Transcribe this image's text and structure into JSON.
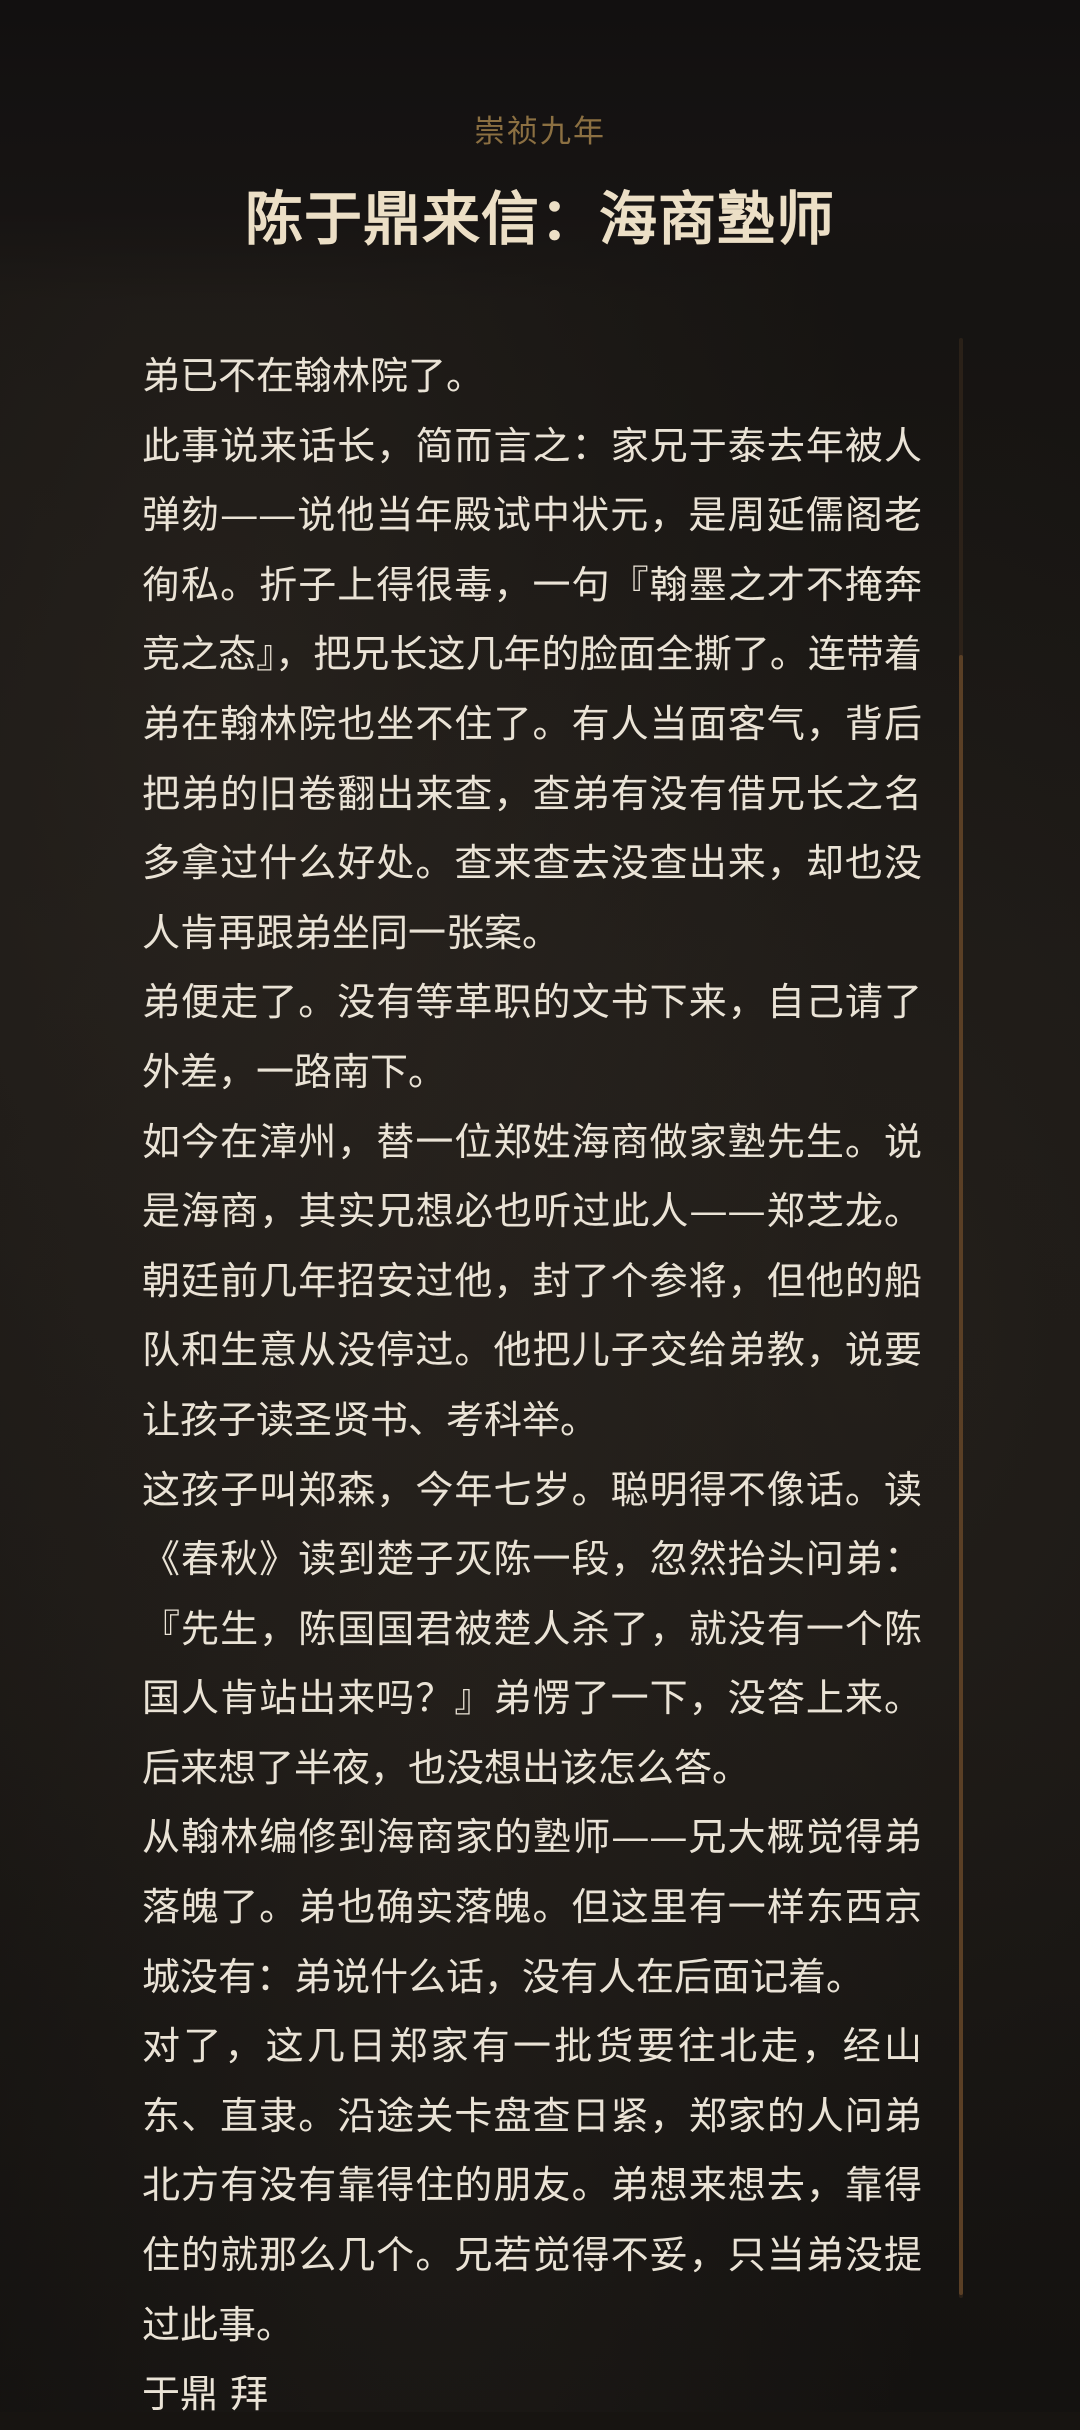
{
  "header": {
    "year": "崇祯九年",
    "title": "陈于鼎来信：海商塾师"
  },
  "letter": {
    "paragraphs": [
      "弟已不在翰林院了。",
      "此事说来话长，简而言之：家兄于泰去年被人弹劾——说他当年殿试中状元，是周延儒阁老徇私。折子上得很毒，一句『翰墨之才不掩奔竞之态』，把兄长这几年的脸面全撕了。连带着弟在翰林院也坐不住了。有人当面客气，背后把弟的旧卷翻出来查，查弟有没有借兄长之名多拿过什么好处。查来查去没查出来，却也没人肯再跟弟坐同一张案。",
      "弟便走了。没有等革职的文书下来，自己请了外差，一路南下。",
      "如今在漳州，替一位郑姓海商做家塾先生。说是海商，其实兄想必也听过此人——郑芝龙。朝廷前几年招安过他，封了个参将，但他的船队和生意从没停过。他把儿子交给弟教，说要让孩子读圣贤书、考科举。",
      "这孩子叫郑森，今年七岁。聪明得不像话。读《春秋》读到楚子灭陈一段，忽然抬头问弟：『先生，陈国国君被楚人杀了，就没有一个陈国人肯站出来吗？』弟愣了一下，没答上来。后来想了半夜，也没想出该怎么答。",
      "从翰林编修到海商家的塾师——兄大概觉得弟落魄了。弟也确实落魄。但这里有一样东西京城没有：弟说什么话，没有人在后面记着。",
      "对了，这几日郑家有一批货要往北走，经山东、直隶。沿途关卡盘查日紧，郑家的人问弟北方有没有靠得住的朋友。弟想来想去，靠得住的就那么几个。兄若觉得不妥，只当弟没提过此事。",
      "于鼎 拜"
    ]
  },
  "colors": {
    "background": "#171411",
    "year": "#8c7042",
    "title": "#ecdfc6",
    "body_text": "#eae3d6",
    "scroll_thumb": "#5a3f25"
  },
  "scroll": {
    "position_fraction": 0.16
  }
}
